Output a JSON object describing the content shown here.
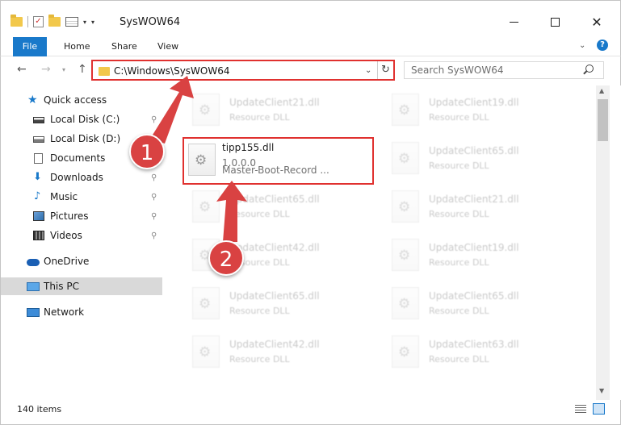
{
  "window": {
    "title": "SysWOW64",
    "minimize_glyph": "—",
    "close_glyph": "✕"
  },
  "ribbon": {
    "tabs": [
      "File",
      "Home",
      "Share",
      "View"
    ],
    "help": "?"
  },
  "navbar": {
    "address": "C:\\Windows\\SysWOW64",
    "search_placeholder": "Search SysWOW64"
  },
  "sidebar": {
    "items": [
      {
        "label": "Quick access",
        "icon": "star-icon"
      },
      {
        "label": "Local Disk (C:)",
        "icon": "drive-icon",
        "pinned": true
      },
      {
        "label": "Local Disk (D:)",
        "icon": "drive-icon",
        "pinned": true
      },
      {
        "label": "Documents",
        "icon": "documents-icon",
        "pinned": true
      },
      {
        "label": "Downloads",
        "icon": "downloads-icon",
        "pinned": true
      },
      {
        "label": "Music",
        "icon": "music-icon",
        "pinned": true
      },
      {
        "label": "Pictures",
        "icon": "pictures-icon",
        "pinned": true
      },
      {
        "label": "Videos",
        "icon": "videos-icon",
        "pinned": true
      },
      {
        "label": "OneDrive",
        "icon": "onedrive-icon"
      },
      {
        "label": "This PC",
        "icon": "this-pc-icon",
        "selected": true
      },
      {
        "label": "Network",
        "icon": "network-icon"
      }
    ]
  },
  "files": {
    "highlighted": {
      "name": "tipp155.dll",
      "version": "1.0.0.0",
      "description": "Master-Boot-Record ..."
    },
    "background": [
      {
        "name": "UpdateClient21.dll",
        "desc": "Resource DLL"
      },
      {
        "name": "UpdateClient19.dll",
        "desc": "Resource DLL"
      },
      {
        "name": "UpdateClient65.dll",
        "desc": "Resource DLL"
      },
      {
        "name": "UpdateClient65.dll",
        "desc": "Resource DLL"
      },
      {
        "name": "UpdateClient21.dll",
        "desc": "Resource DLL"
      },
      {
        "name": "UpdateClient42.dll",
        "desc": "Resource DLL"
      },
      {
        "name": "UpdateClient19.dll",
        "desc": "Resource DLL"
      },
      {
        "name": "UpdateClient65.dll",
        "desc": "Resource DLL"
      },
      {
        "name": "UpdateClient65.dll",
        "desc": "Resource DLL"
      },
      {
        "name": "UpdateClient42.dll",
        "desc": "Resource DLL"
      },
      {
        "name": "UpdateClient63.dll",
        "desc": "Resource DLL"
      }
    ]
  },
  "status": {
    "item_count": "140 items"
  },
  "annotations": {
    "step1": "1",
    "step2": "2",
    "arrow_color": "#d94242"
  },
  "colors": {
    "accent": "#1979ca",
    "highlight_border": "#e0312f"
  }
}
